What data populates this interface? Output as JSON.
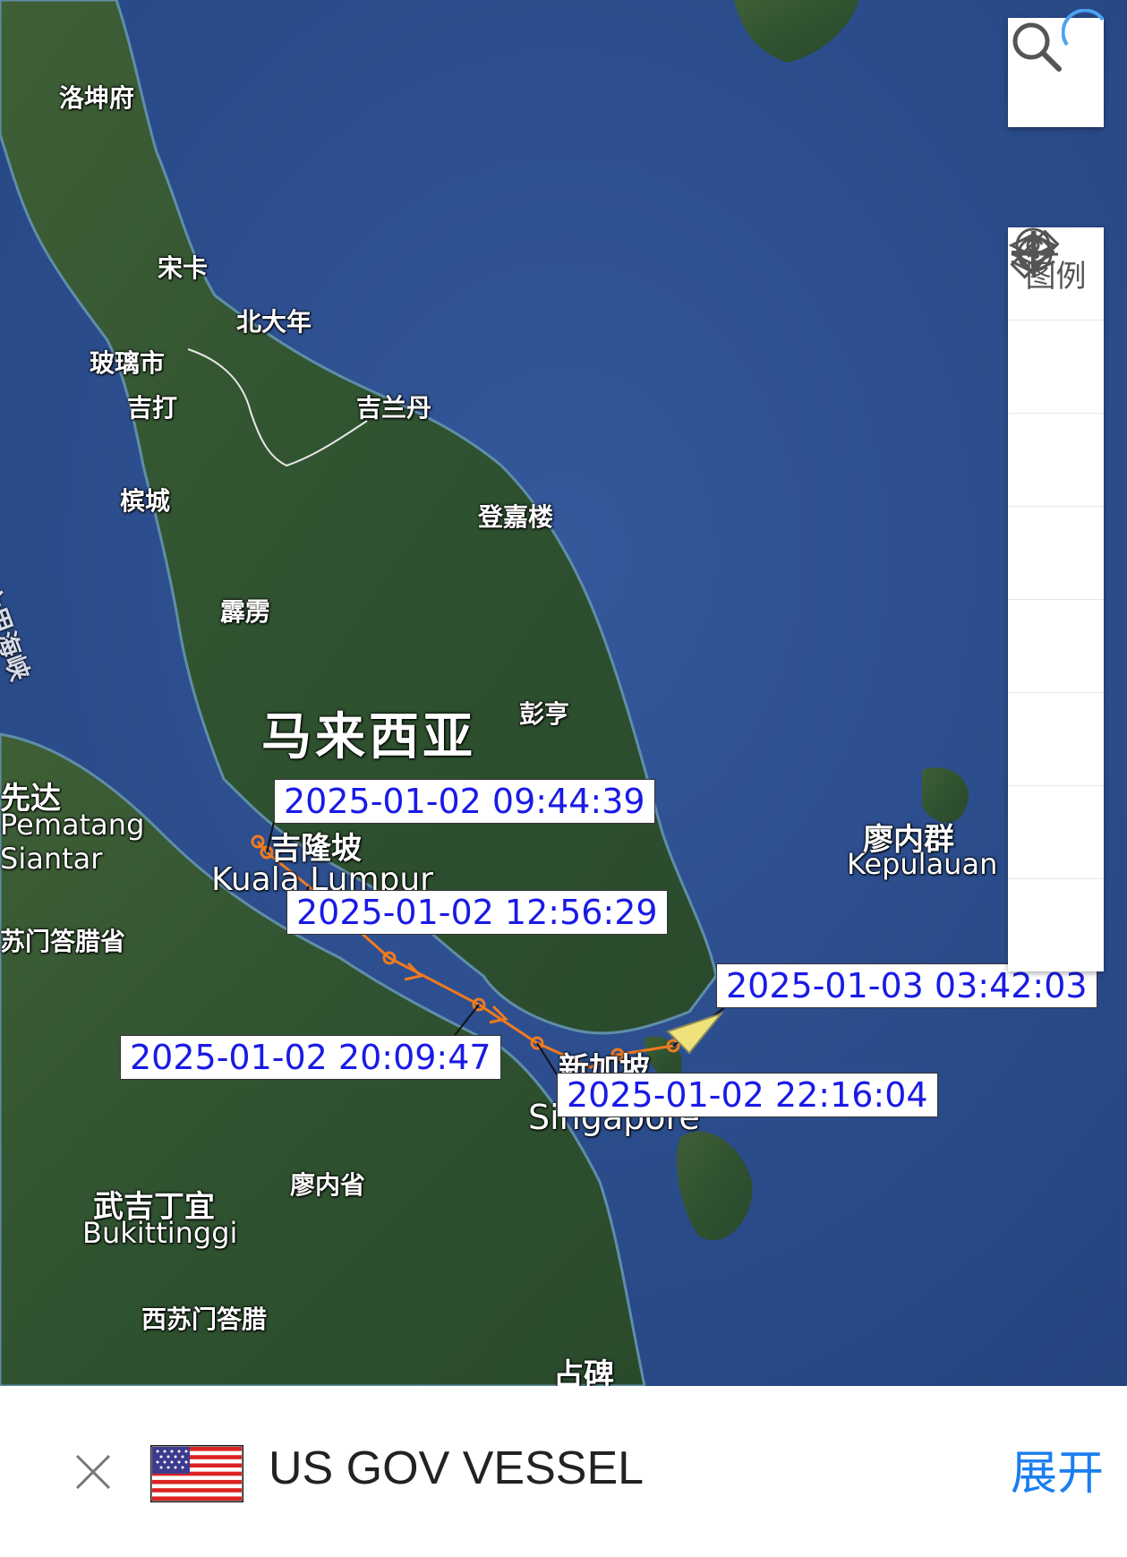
{
  "map": {
    "places": [
      {
        "id": "luokunfu",
        "text": "洛坤府"
      },
      {
        "id": "songka",
        "text": "宋卡"
      },
      {
        "id": "beidanian",
        "text": "北大年"
      },
      {
        "id": "bolishi",
        "text": "玻璃市"
      },
      {
        "id": "jida",
        "text": "吉打"
      },
      {
        "id": "jilandan",
        "text": "吉兰丹"
      },
      {
        "id": "bincheng",
        "text": "槟城"
      },
      {
        "id": "dengjialou",
        "text": "登嘉楼"
      },
      {
        "id": "pili",
        "text": "霹雳"
      },
      {
        "id": "malaixiya",
        "text": "马来西亚"
      },
      {
        "id": "pengheng",
        "text": "彭亨"
      },
      {
        "id": "xianda",
        "text": "先达"
      },
      {
        "id": "pematang",
        "text": "Pematang"
      },
      {
        "id": "siantar",
        "text": "Siantar"
      },
      {
        "id": "jilongpo",
        "text": "吉隆坡"
      },
      {
        "id": "kualalumpur",
        "text": "Kuala Lumpur"
      },
      {
        "id": "sumenda",
        "text": "苏门答腊省"
      },
      {
        "id": "liaoneiqundao",
        "text": "廖内群"
      },
      {
        "id": "kepulauan",
        "text": "Kepulauan"
      },
      {
        "id": "xinjiapo",
        "text": "新加坡"
      },
      {
        "id": "singapore",
        "text": "Singapore"
      },
      {
        "id": "liaoneisheng",
        "text": "廖内省"
      },
      {
        "id": "wujidingyi",
        "text": "武吉丁宜"
      },
      {
        "id": "bukittinggi",
        "text": "Bukittinggi"
      },
      {
        "id": "xisumendala",
        "text": "西苏门答腊"
      },
      {
        "id": "zhanbei",
        "text": "占碑"
      },
      {
        "id": "strait",
        "text": "马六甲海峡"
      }
    ],
    "track_labels": [
      "2025-01-02 09:44:39",
      "2025-01-02 12:56:29",
      "2025-01-02 20:09:47",
      "2025-01-02 22:16:04",
      "2025-01-03 03:42:03"
    ],
    "colors": {
      "track": "#f07a1f",
      "label_text": "#1a1ae6",
      "vessel": "#f0e27a",
      "expand": "#1a7ef0"
    }
  },
  "toolbar": {
    "search_icon": "search-icon",
    "legend_label": "图例",
    "tools": [
      "layers-icon",
      "map-pin-icon",
      "ruler-icon",
      "crosshair-icon",
      "locate-icon",
      "zoom-in-icon",
      "zoom-out-icon"
    ]
  },
  "vessel_panel": {
    "flag": "us-flag-icon",
    "name": "US GOV VESSEL",
    "expand_label": "展开",
    "close_icon": "close-icon"
  }
}
